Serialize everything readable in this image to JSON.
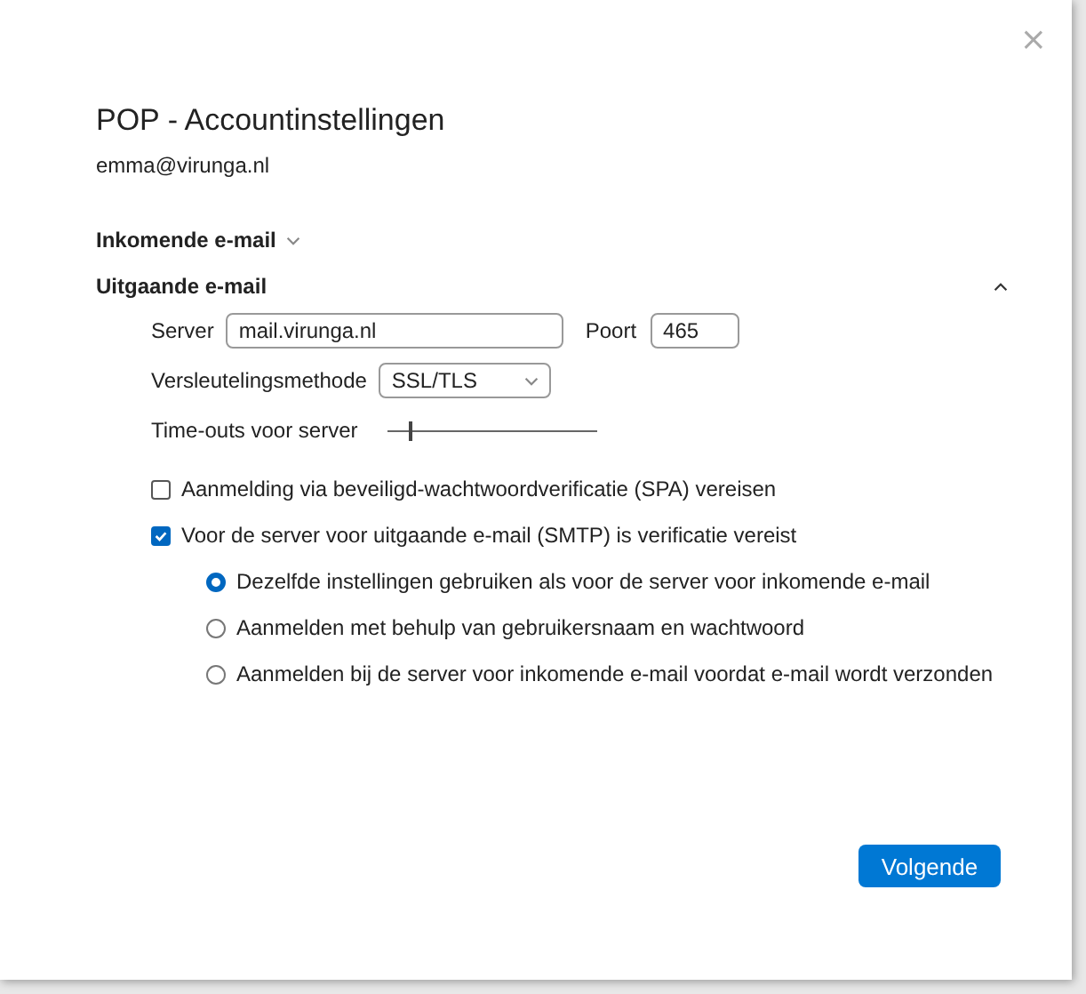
{
  "window": {
    "close": "×"
  },
  "title": "POP - Accountinstellingen",
  "account": "emma@virunga.nl",
  "sections": [
    {
      "label": "Inkomende e-mail",
      "expanded": false
    },
    {
      "label": "Uitgaande e-mail",
      "expanded": true,
      "server": {
        "label": "Server",
        "value": "mail.virunga.nl"
      },
      "port": {
        "label": "Poort",
        "value": "465"
      },
      "encryption": {
        "label": "Versleutelingsmethode",
        "value": "SSL/TLS"
      },
      "timeout": {
        "label": "Time-outs voor server",
        "level": 0.1
      },
      "checkboxes": [
        {
          "label": "Aanmelding via beveiligd-wachtwoordverificatie (SPA) vereisen",
          "checked": false
        },
        {
          "label": "Voor de server voor uitgaande e-mail (SMTP) is verificatie vereist",
          "checked": true
        }
      ],
      "radios": [
        {
          "label": "Dezelfde instellingen gebruiken als voor de server voor inkomende e-mail",
          "selected": true
        },
        {
          "label": "Aanmelden met behulp van gebruikersnaam en wachtwoord",
          "selected": false
        },
        {
          "label": "Aanmelden bij de server voor inkomende e-mail voordat e-mail wordt verzonden",
          "selected": false
        }
      ]
    }
  ],
  "buttons": [
    "Volgende"
  ]
}
